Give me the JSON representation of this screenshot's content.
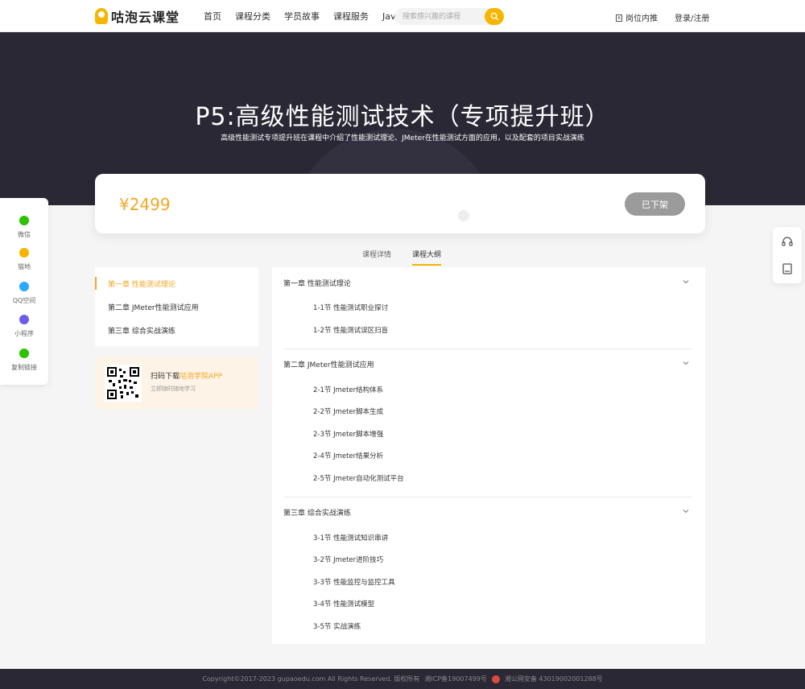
{
  "header": {
    "logo_text": "咕泡云课堂",
    "nav": [
      "首页",
      "课程分类",
      "学员故事",
      "课程服务",
      "Java定制"
    ],
    "search_placeholder": "搜索感兴趣的课程",
    "job_label": "岗位内推",
    "login_label": "登录/注册"
  },
  "hero": {
    "title": "P5:高级性能测试技术（专项提升班）",
    "subtitle": "高级性能测试专项提升班在课程中介绍了性能测试理论、JMeter在性能测试方面的应用，以及配套的项目实战演练"
  },
  "course": {
    "price": "¥2499",
    "status_label": "已下架"
  },
  "share": [
    {
      "label": "微信",
      "icon": "wechat-icon",
      "color": "#2dc100"
    },
    {
      "label": "猫地",
      "icon": "cat-icon",
      "color": "#f7b500"
    },
    {
      "label": "QQ空间",
      "icon": "qzone-icon",
      "color": "#2aa8ff"
    },
    {
      "label": "小程序",
      "icon": "mini-program-icon",
      "color": "#6c5ce7"
    },
    {
      "label": "复制链接",
      "icon": "link-icon",
      "color": "#2dc100"
    }
  ],
  "tabs": [
    "课程详情",
    "课程大纲"
  ],
  "active_tab": "课程大纲",
  "chapter_nav": [
    "第一章 性能测试理论",
    "第二章 JMeter性能测试应用",
    "第三章 综合实战演练"
  ],
  "qr_card": {
    "line1_prefix": "扫码下载",
    "line1_highlight": "咕泡学院APP",
    "line2": "立即随时随地学习"
  },
  "syllabus": [
    {
      "title": "第一章 性能测试理论",
      "sections": [
        "1-1节 性能测试职业探讨",
        "1-2节 性能测试误区扫盲"
      ]
    },
    {
      "title": "第二章 JMeter性能测试应用",
      "sections": [
        "2-1节 Jmeter结构体系",
        "2-2节 Jmeter脚本生成",
        "2-3节 Jmeter脚本增强",
        "2-4节 Jmeter结果分析",
        "2-5节 Jmeter自动化测试平台"
      ]
    },
    {
      "title": "第三章 综合实战演练",
      "sections": [
        "3-1节 性能测试知识串讲",
        "3-2节 Jmeter进阶技巧",
        "3-3节 性能监控与监控工具",
        "3-4节 性能测试模型",
        "3-5节 实战演练"
      ]
    }
  ],
  "footer": {
    "copyright": "Copyright©2017-2023 gupaoedu.com All Rights Reserved. 版权所有",
    "icp": "湘ICP备19007499号",
    "police": "湘公网安备 43019002001288号"
  },
  "colors": {
    "accent": "#f7b500",
    "accent_text": "#f5a623",
    "hero_bg": "#2a2835"
  }
}
